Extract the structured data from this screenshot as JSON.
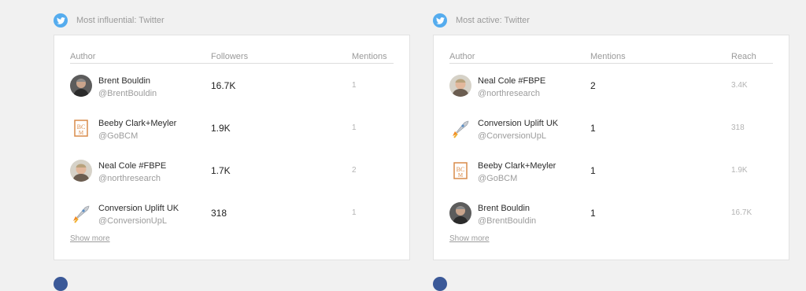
{
  "influential": {
    "title": "Most influential: Twitter",
    "headers": {
      "author": "Author",
      "metric1": "Followers",
      "metric2": "Mentions"
    },
    "rows": [
      {
        "name": "Brent Bouldin",
        "handle": "@BrentBouldin",
        "metric1": "16.7K",
        "metric2": "1",
        "avatar": "person-avatar-dark"
      },
      {
        "name": "Beeby Clark+Meyler",
        "handle": "@GoBCM",
        "metric1": "1.9K",
        "metric2": "1",
        "avatar": "bcm-logo"
      },
      {
        "name": "Neal Cole #FBPE",
        "handle": "@northresearch",
        "metric1": "1.7K",
        "metric2": "2",
        "avatar": "person-avatar-light"
      },
      {
        "name": "Conversion Uplift UK",
        "handle": "@ConversionUpL",
        "metric1": "318",
        "metric2": "1",
        "avatar": "rocket-logo"
      }
    ],
    "show_more": "Show more"
  },
  "active": {
    "title": "Most active: Twitter",
    "headers": {
      "author": "Author",
      "metric1": "Mentions",
      "metric2": "Reach"
    },
    "rows": [
      {
        "name": "Neal Cole #FBPE",
        "handle": "@northresearch",
        "metric1": "2",
        "metric2": "3.4K",
        "avatar": "person-avatar-light"
      },
      {
        "name": "Conversion Uplift UK",
        "handle": "@ConversionUpL",
        "metric1": "1",
        "metric2": "318",
        "avatar": "rocket-logo"
      },
      {
        "name": "Beeby Clark+Meyler",
        "handle": "@GoBCM",
        "metric1": "1",
        "metric2": "1.9K",
        "avatar": "bcm-logo"
      },
      {
        "name": "Brent Bouldin",
        "handle": "@BrentBouldin",
        "metric1": "1",
        "metric2": "16.7K",
        "avatar": "person-avatar-dark"
      }
    ],
    "show_more": "Show more"
  },
  "colors": {
    "twitter": "#55acee",
    "facebook": "#3b5998",
    "background": "#f1f1f1"
  }
}
